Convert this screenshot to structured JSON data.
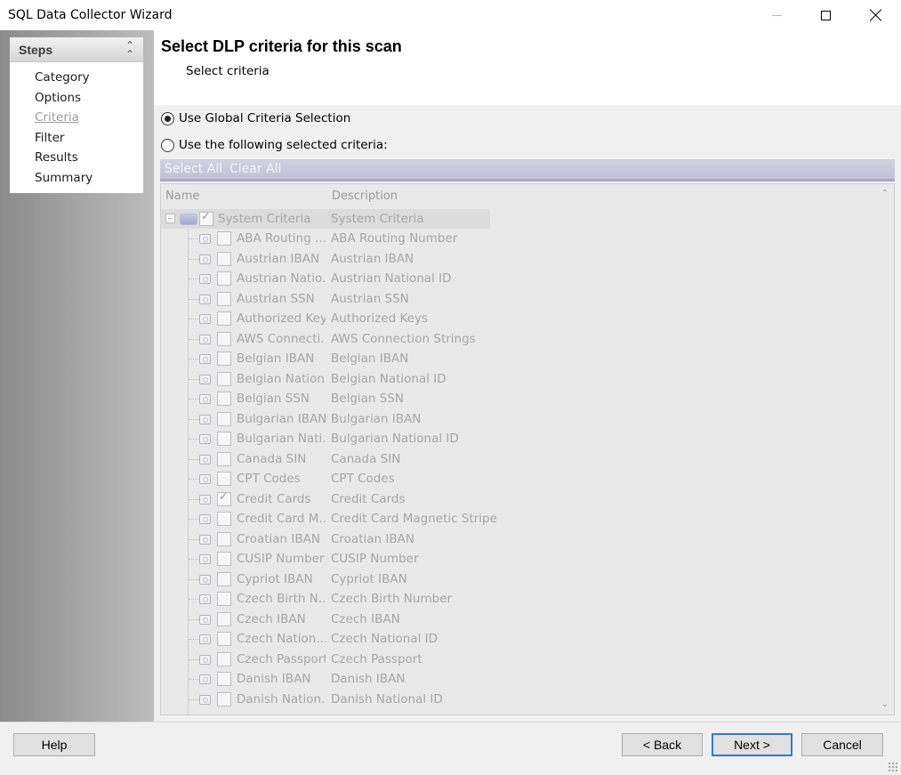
{
  "window": {
    "title": "SQL Data Collector Wizard"
  },
  "steps": {
    "header": "Steps",
    "items": [
      "Category",
      "Options",
      "Criteria",
      "Filter",
      "Results",
      "Summary"
    ],
    "current": "Criteria"
  },
  "page": {
    "title": "Select DLP criteria for this scan",
    "subtitle": "Select criteria"
  },
  "criteria_mode": {
    "global_label": "Use Global Criteria Selection",
    "selected_label": "Use the following selected criteria:",
    "selected": "global"
  },
  "toolbar": {
    "select_all": "Select All",
    "clear_all": "Clear All"
  },
  "tree": {
    "columns": {
      "name": "Name",
      "description": "Description"
    },
    "root": {
      "name": "System Criteria",
      "description": "System Criteria",
      "checked": true
    },
    "items": [
      {
        "name": "ABA Routing ...",
        "description": "ABA Routing Number",
        "checked": false
      },
      {
        "name": "Austrian IBAN",
        "description": "Austrian IBAN",
        "checked": false
      },
      {
        "name": "Austrian Natio...",
        "description": "Austrian National ID",
        "checked": false
      },
      {
        "name": "Austrian SSN",
        "description": "Austrian SSN",
        "checked": false
      },
      {
        "name": "Authorized Keys",
        "description": "Authorized Keys",
        "checked": false
      },
      {
        "name": "AWS Connecti...",
        "description": "AWS Connection Strings",
        "checked": false
      },
      {
        "name": "Belgian IBAN",
        "description": "Belgian IBAN",
        "checked": false
      },
      {
        "name": "Belgian Nation...",
        "description": "Belgian National ID",
        "checked": false
      },
      {
        "name": "Belgian SSN",
        "description": "Belgian SSN",
        "checked": false
      },
      {
        "name": "Bulgarian IBAN",
        "description": "Bulgarian IBAN",
        "checked": false
      },
      {
        "name": "Bulgarian Nati...",
        "description": "Bulgarian National ID",
        "checked": false
      },
      {
        "name": "Canada SIN",
        "description": "Canada SIN",
        "checked": false
      },
      {
        "name": "CPT Codes",
        "description": "CPT Codes",
        "checked": false
      },
      {
        "name": "Credit Cards",
        "description": "Credit Cards",
        "checked": true
      },
      {
        "name": "Credit Card M...",
        "description": "Credit Card Magnetic Stripe",
        "checked": false
      },
      {
        "name": "Croatian IBAN",
        "description": "Croatian IBAN",
        "checked": false
      },
      {
        "name": "CUSIP Number",
        "description": "CUSIP Number",
        "checked": false
      },
      {
        "name": "Cypriot IBAN",
        "description": "Cypriot IBAN",
        "checked": false
      },
      {
        "name": "Czech Birth N...",
        "description": "Czech Birth Number",
        "checked": false
      },
      {
        "name": "Czech IBAN",
        "description": "Czech IBAN",
        "checked": false
      },
      {
        "name": "Czech Nation...",
        "description": "Czech National ID",
        "checked": false
      },
      {
        "name": "Czech Passport",
        "description": "Czech Passport",
        "checked": false
      },
      {
        "name": "Danish IBAN",
        "description": "Danish IBAN",
        "checked": false
      },
      {
        "name": "Danish Nation...",
        "description": "Danish National ID",
        "checked": false
      }
    ]
  },
  "buttons": {
    "help": "Help",
    "back": "< Back",
    "next": "Next >",
    "cancel": "Cancel"
  }
}
